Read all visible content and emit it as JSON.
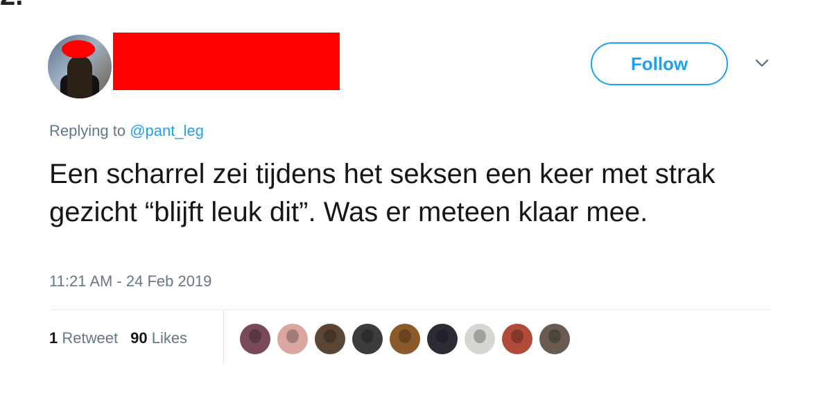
{
  "corner_label": "2.",
  "follow_label": "Follow",
  "replying": {
    "prefix": "Replying to",
    "handle": "@pant_leg"
  },
  "tweet_text": "Een scharrel zei tijdens het seksen een keer met strak gezicht “blijft leuk dit”. Was er meteen klaar mee.",
  "timestamp": "11:21 AM - 24 Feb 2019",
  "stats": {
    "retweet_count": "1",
    "retweet_label": "Retweet",
    "like_count": "90",
    "like_label": "Likes"
  },
  "colors": {
    "accent": "#1da1f2",
    "secondary_text": "#657786",
    "redaction": "#ff0000"
  },
  "liker_avatars": [
    {
      "color": "#7a4a5c"
    },
    {
      "color": "#d9a7a0"
    },
    {
      "color": "#5b4636"
    },
    {
      "color": "#3c3c3c"
    },
    {
      "color": "#8a5a2b"
    },
    {
      "color": "#2c2c34"
    },
    {
      "color": "#d8d6d2"
    },
    {
      "color": "#b04a3a"
    },
    {
      "color": "#6a5a52"
    }
  ]
}
